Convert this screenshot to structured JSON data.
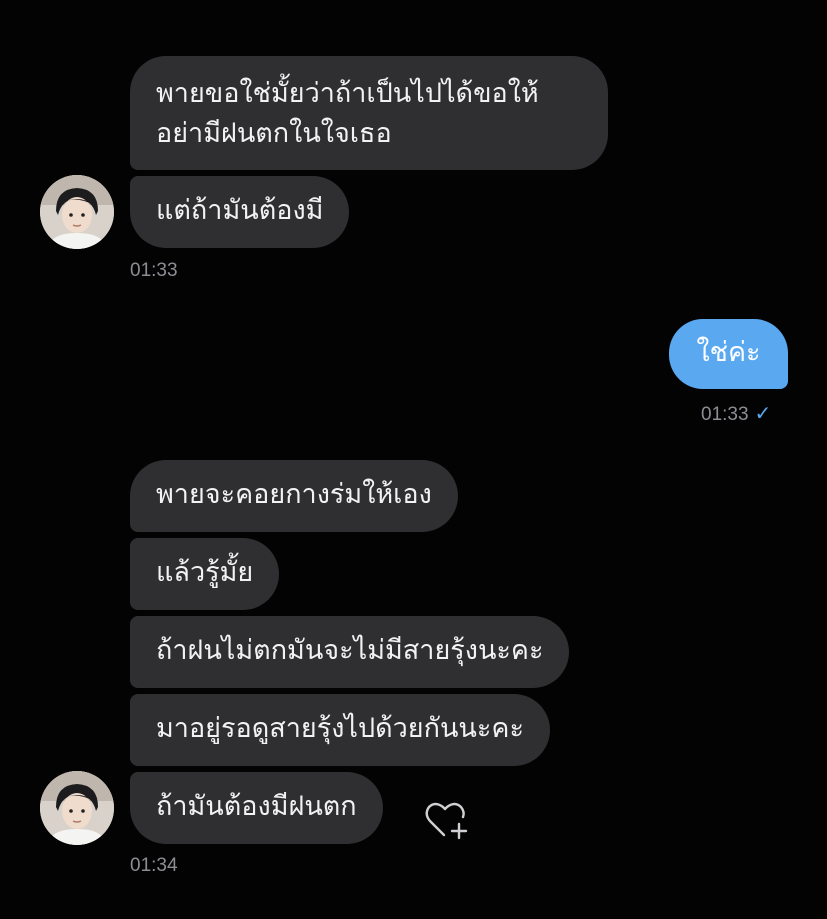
{
  "conversation": {
    "group1": {
      "messages": [
        "พายขอใช่มั้ยว่าถ้าเป็นไปได้ขอให้",
        "อย่ามีฝนตกในใจเธอ",
        "แต่ถ้ามันต้องมี"
      ],
      "time": "01:33"
    },
    "sent": {
      "message": "ใช่ค่ะ",
      "time": "01:33",
      "status_icon": "check-icon"
    },
    "group2": {
      "messages": [
        "พายจะคอยกางร่มให้เอง",
        "แล้วรู้มั้ย",
        "ถ้าฝนไม่ตกมันจะไม่มีสายรุ้งนะคะ",
        "มาอยู่รอดูสายรุ้งไปด้วยกันนะคะ",
        "ถ้ามันต้องมีฝนตก"
      ],
      "time": "01:34"
    },
    "colors": {
      "background": "#030303",
      "received_bubble": "#2f2f31",
      "sent_bubble": "#5aa9f0",
      "timestamp": "#8d8d93"
    }
  }
}
